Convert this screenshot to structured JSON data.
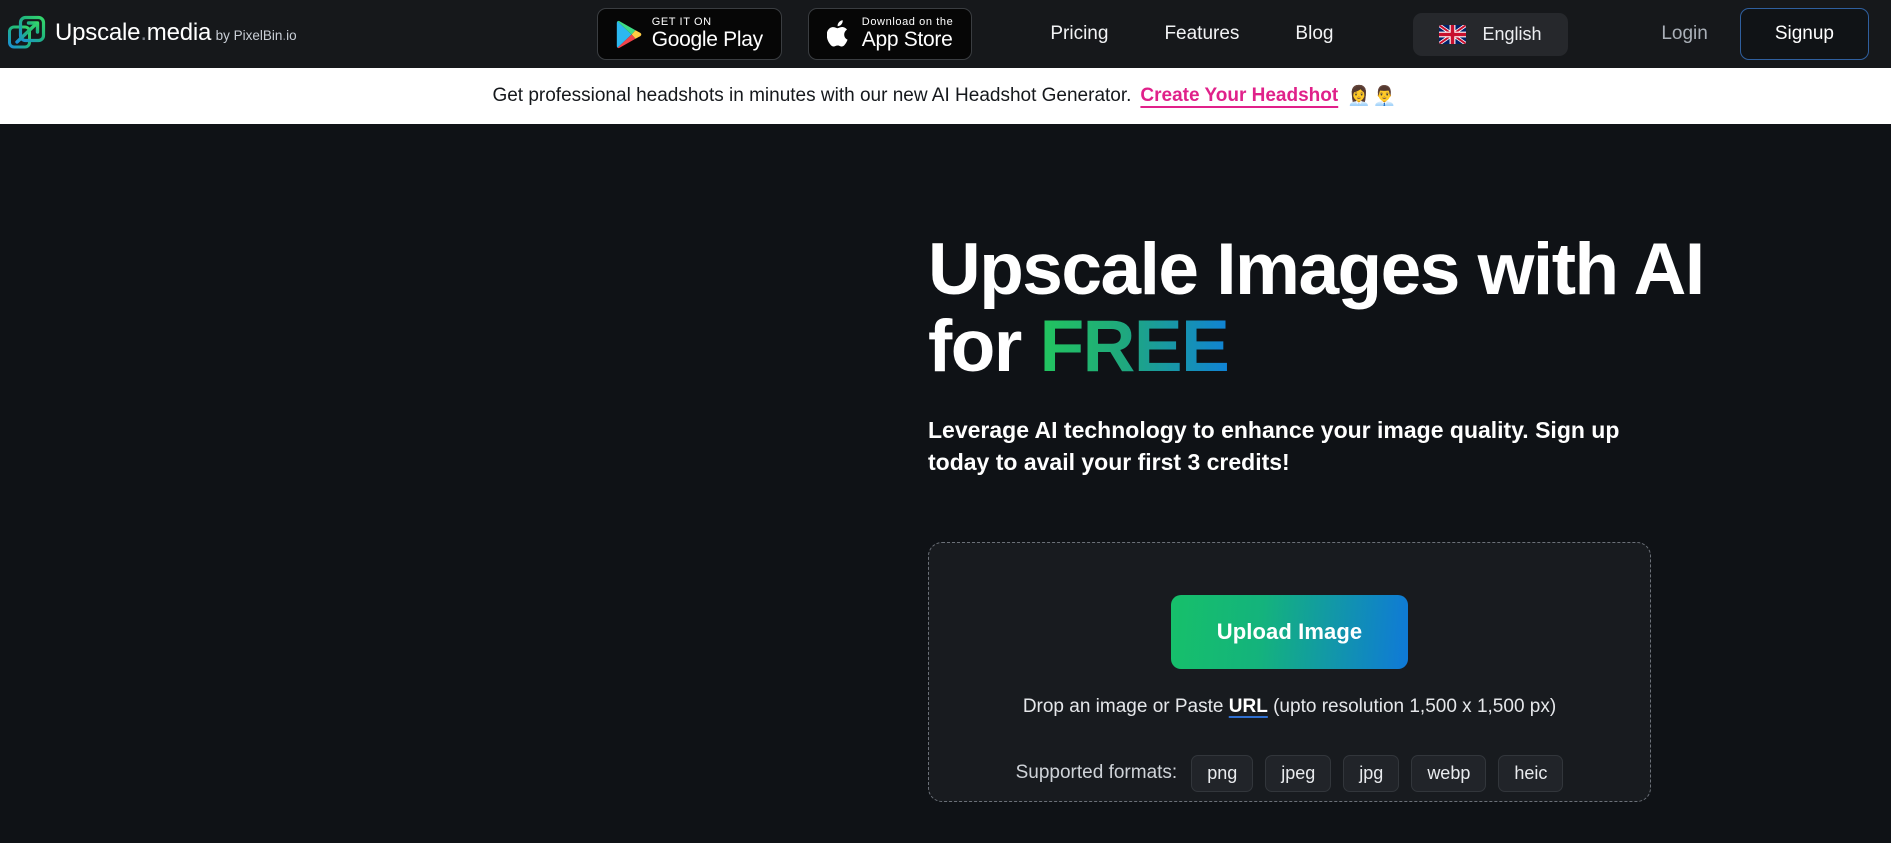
{
  "brand": {
    "name_main": "Upscale",
    "name_dot": ".",
    "name_suffix": "media",
    "byline_prefix": "by PixelBin",
    "byline_dot": ".",
    "byline_suffix": "io",
    "logo_icon": "upscale-arrow-logo-icon"
  },
  "header": {
    "google_play": {
      "small": "GET IT ON",
      "big": "Google Play",
      "icon": "google-play-icon"
    },
    "app_store": {
      "small": "Download on the",
      "big": "App Store",
      "icon": "apple-icon"
    },
    "nav": [
      {
        "label": "Pricing",
        "name": "nav-link-pricing"
      },
      {
        "label": "Features",
        "name": "nav-link-features"
      },
      {
        "label": "Blog",
        "name": "nav-link-blog"
      }
    ],
    "language": {
      "label": "English",
      "flag_icon": "uk-flag-icon"
    },
    "login_label": "Login",
    "signup_label": "Signup"
  },
  "banner": {
    "text": "Get professional headshots in minutes with our new AI Headshot Generator.",
    "link_label": "Create Your Headshot",
    "emoji": "👩‍💼👨‍💼",
    "link_color": "#e0218a"
  },
  "hero": {
    "headline_line1": "Upscale Images with AI",
    "headline_line2_prefix": "for ",
    "headline_highlight": "FREE",
    "highlight_gradient_from": "#22c55e",
    "highlight_gradient_to": "#1083d6",
    "subhead": "Leverage AI technology to enhance your image quality. Sign up today to avail your first 3 credits!"
  },
  "upload": {
    "button_label": "Upload Image",
    "button_gradient_from": "#16c06a",
    "button_gradient_to": "#0f79d8",
    "drop_prefix": "Drop an image or Paste ",
    "drop_link": "URL",
    "drop_suffix": " (upto resolution 1,500 x 1,500 px)",
    "formats_label": "Supported formats:",
    "formats": [
      "png",
      "jpeg",
      "jpg",
      "webp",
      "heic"
    ]
  }
}
